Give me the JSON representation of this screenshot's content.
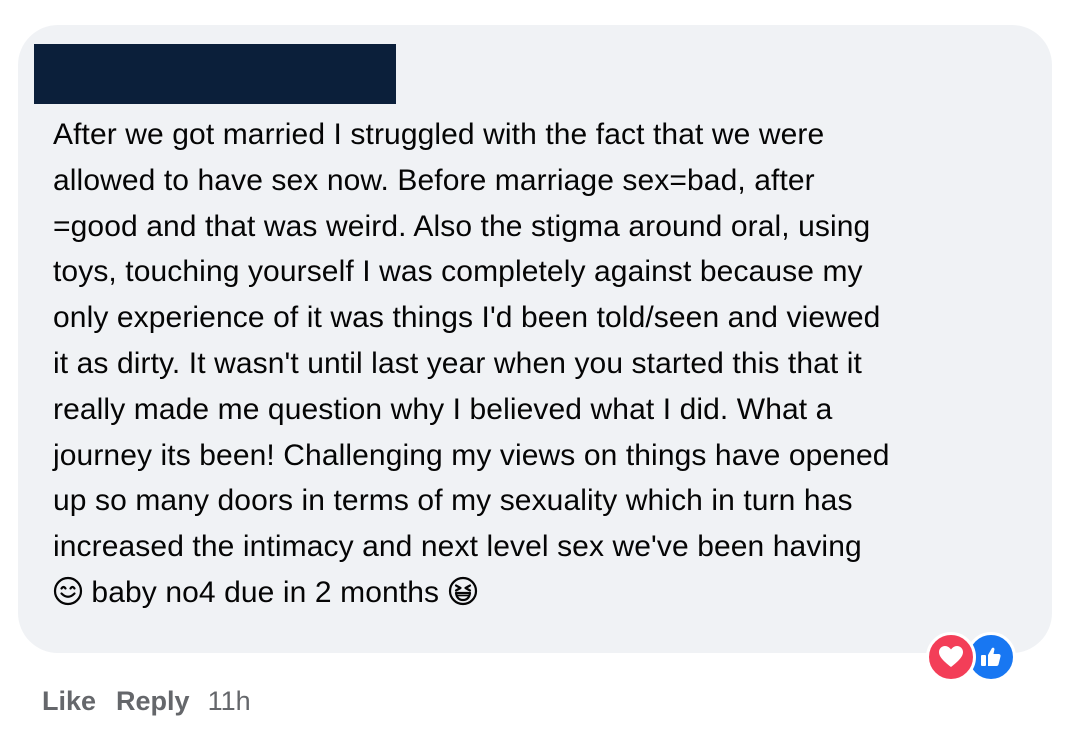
{
  "comment": {
    "author_redacted": true,
    "lines": [
      "After we got married I struggled with the fact that we were",
      "allowed to have sex now. Before marriage sex=bad, after",
      "=good and that was weird. Also the stigma around oral, using",
      "toys, touching yourself I was completely against because my",
      "only experience of it was things I'd been told/seen and viewed",
      "it as dirty. It wasn't until last year when you started this that it",
      "really made me question why I believed what I did. What a",
      "journey its been! Challenging my views on things have opened",
      "up so many doors in terms of my sexuality which in turn has",
      "increased the intimacy and next level sex we've been having"
    ],
    "last_line": {
      "leading_emoji": "smiling-face-icon",
      "text": " baby no4 due in 2 months ",
      "trailing_emoji": "grinning-squinting-face-icon"
    }
  },
  "reactions": [
    {
      "name": "love-reaction-icon",
      "color": "#f33e58"
    },
    {
      "name": "like-reaction-icon",
      "color": "#1877f2"
    }
  ],
  "actions": {
    "like_label": "Like",
    "reply_label": "Reply",
    "timestamp": "11h"
  },
  "colors": {
    "bubble_bg": "#f0f2f5",
    "text": "#050505",
    "meta_text": "#65676b",
    "redaction": "#0b1f3a"
  }
}
